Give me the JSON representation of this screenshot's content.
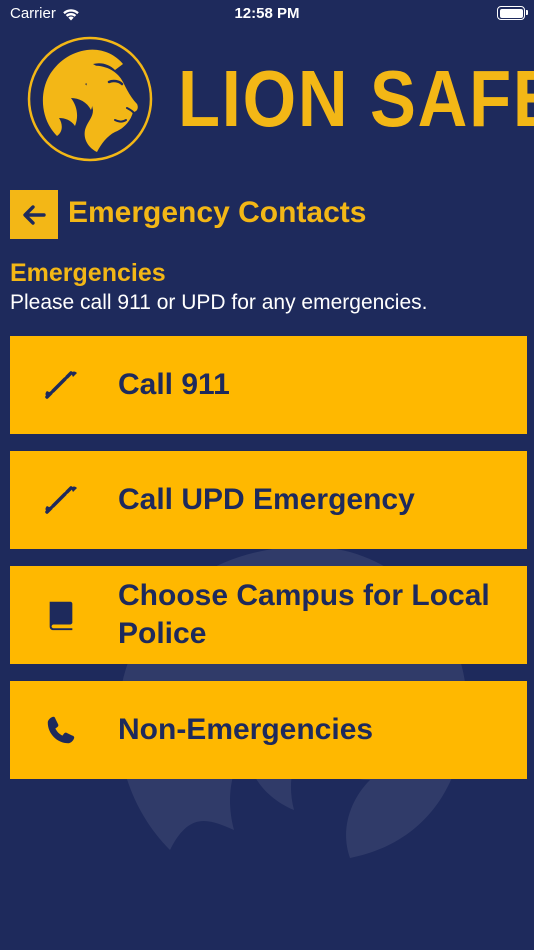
{
  "status_bar": {
    "carrier": "Carrier",
    "time": "12:58 PM"
  },
  "header": {
    "brand": "LION SAFE",
    "logo_icon": "lion-head-icon"
  },
  "page": {
    "title": "Emergency Contacts",
    "back_icon": "arrow-left-icon"
  },
  "section": {
    "heading": "Emergencies",
    "description": "Please call 911 or UPD for any emergencies."
  },
  "actions": [
    {
      "label": "Call 911",
      "icon": "phone-call-icon"
    },
    {
      "label": "Call UPD Emergency",
      "icon": "phone-call-icon"
    },
    {
      "label": "Choose Campus for Local Police",
      "icon": "book-icon"
    },
    {
      "label": "Non-Emergencies",
      "icon": "phone-icon"
    }
  ],
  "colors": {
    "background": "#1e2a5c",
    "accent": "#f3b716",
    "button": "#ffb800",
    "button_text": "#1e2a5c",
    "status_text": "#ffffff"
  }
}
